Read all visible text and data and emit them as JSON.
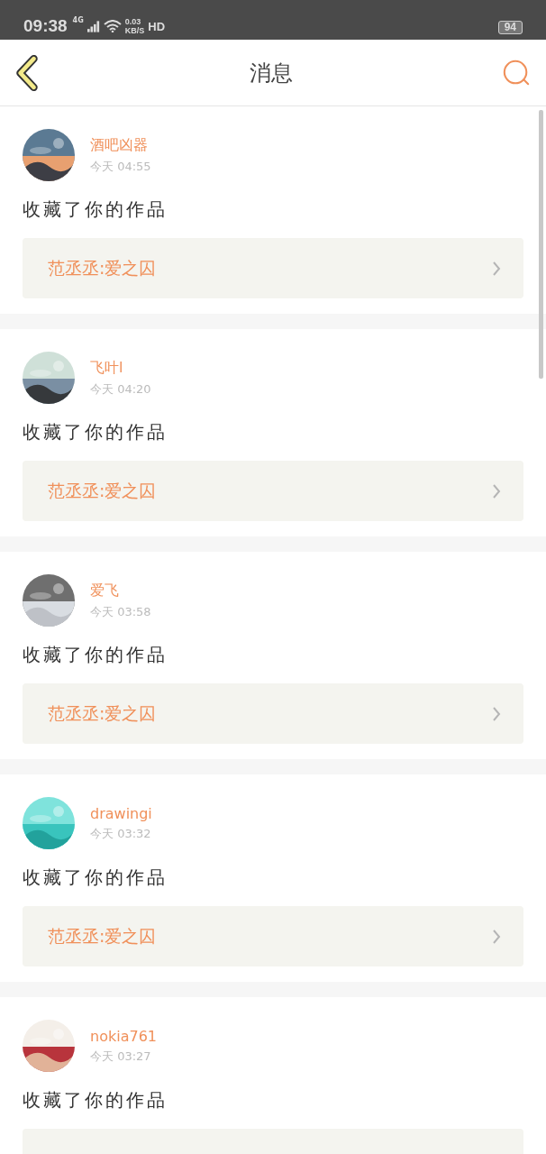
{
  "status_bar": {
    "time": "09:38",
    "network": "4G",
    "speed": "0.03",
    "speed_unit": "KB/S",
    "hd": "HD",
    "battery": "94"
  },
  "header": {
    "title": "消息"
  },
  "messages": [
    {
      "name": "酒吧凶器",
      "time": "今天 04:55",
      "action": "收藏了你的作品",
      "work": "范丞丞:爱之囚"
    },
    {
      "name": "飞叶l",
      "time": "今天 04:20",
      "action": "收藏了你的作品",
      "work": "范丞丞:爱之囚"
    },
    {
      "name": "爱飞",
      "time": "今天 03:58",
      "action": "收藏了你的作品",
      "work": "范丞丞:爱之囚"
    },
    {
      "name": "drawingi",
      "time": "今天 03:32",
      "action": "收藏了你的作品",
      "work": "范丞丞:爱之囚"
    },
    {
      "name": "nokia761",
      "time": "今天 03:27",
      "action": "收藏了你的作品"
    }
  ]
}
